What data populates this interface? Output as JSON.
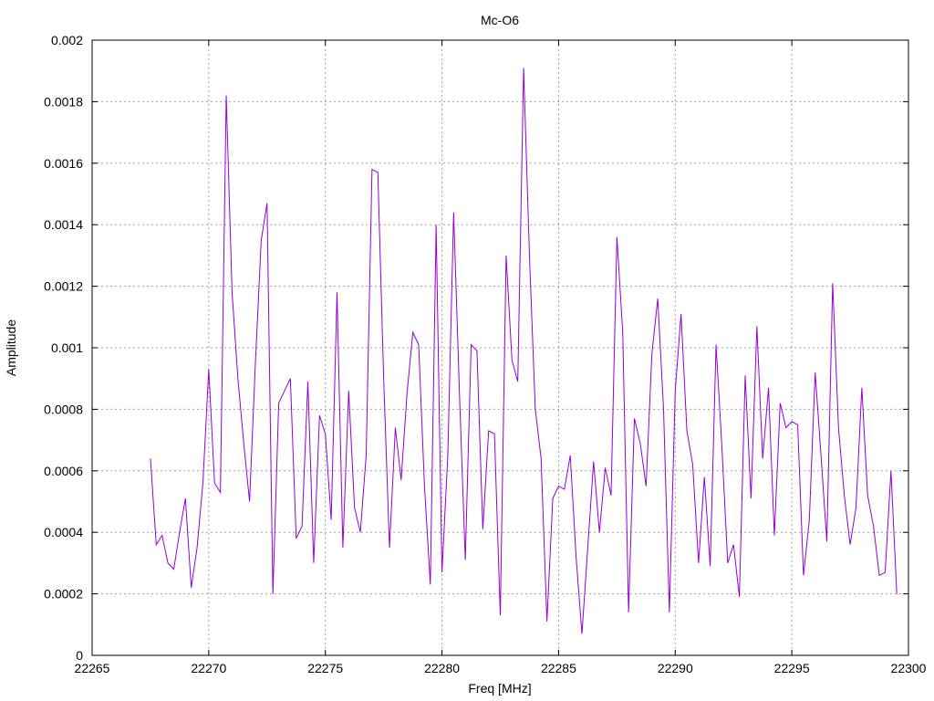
{
  "chart_data": {
    "type": "line",
    "title": "Mc-O6",
    "xlabel": "Freq [MHz]",
    "ylabel": "Amplitude",
    "xlim": [
      22265,
      22300
    ],
    "ylim": [
      0,
      0.002
    ],
    "x_ticks": [
      "22265",
      "22270",
      "22275",
      "22280",
      "22285",
      "22290",
      "22295",
      "22300"
    ],
    "y_ticks": [
      "0",
      "0.0002",
      "0.0004",
      "0.0006",
      "0.0008",
      "0.001",
      "0.0012",
      "0.0014",
      "0.0016",
      "0.0018",
      "0.002"
    ],
    "grid": true,
    "legend": "none",
    "line_color": "#9400d3",
    "series": [
      {
        "x": [
          22267.5,
          22267.75,
          22268.0,
          22268.25,
          22268.5,
          22268.75,
          22269.0,
          22269.25,
          22269.5,
          22269.75,
          22270.0,
          22270.25,
          22270.5,
          22270.75,
          22271.0,
          22271.25,
          22271.5,
          22271.75,
          22272.0,
          22272.25,
          22272.5,
          22272.75,
          22273.0,
          22273.25,
          22273.5,
          22273.75,
          22274.0,
          22274.25,
          22274.5,
          22274.75,
          22275.0,
          22275.25,
          22275.5,
          22275.75,
          22276.0,
          22276.25,
          22276.5,
          22276.75,
          22277.0,
          22277.25,
          22277.5,
          22277.75,
          22278.0,
          22278.25,
          22278.5,
          22278.75,
          22279.0,
          22279.25,
          22279.5,
          22279.75,
          22280.0,
          22280.25,
          22280.5,
          22280.75,
          22281.0,
          22281.25,
          22281.5,
          22281.75,
          22282.0,
          22282.25,
          22282.5,
          22282.75,
          22283.0,
          22283.25,
          22283.5,
          22283.75,
          22284.0,
          22284.25,
          22284.5,
          22284.75,
          22285.0,
          22285.25,
          22285.5,
          22285.75,
          22286.0,
          22286.25,
          22286.5,
          22286.75,
          22287.0,
          22287.25,
          22287.5,
          22287.75,
          22288.0,
          22288.25,
          22288.5,
          22288.75,
          22289.0,
          22289.25,
          22289.5,
          22289.75,
          22290.0,
          22290.25,
          22290.5,
          22290.75,
          22291.0,
          22291.25,
          22291.5,
          22291.75,
          22292.0,
          22292.25,
          22292.5,
          22292.75,
          22293.0,
          22293.25,
          22293.5,
          22293.75,
          22294.0,
          22294.25,
          22294.5,
          22294.75,
          22295.0,
          22295.25,
          22295.5,
          22295.75,
          22296.0,
          22296.25,
          22296.5,
          22296.75,
          22297.0,
          22297.25,
          22297.5,
          22297.75,
          22298.0,
          22298.25,
          22298.5,
          22298.75,
          22299.0,
          22299.25,
          22299.5
        ],
        "values": [
          0.00064,
          0.00036,
          0.00039,
          0.0003,
          0.00028,
          0.0004,
          0.00051,
          0.00022,
          0.00035,
          0.00056,
          0.00093,
          0.00056,
          0.00053,
          0.00182,
          0.00118,
          0.0009,
          0.00069,
          0.0005,
          0.00095,
          0.00135,
          0.00147,
          0.0002,
          0.00082,
          0.00086,
          0.0009,
          0.00038,
          0.00042,
          0.00089,
          0.0003,
          0.00078,
          0.00072,
          0.00044,
          0.00118,
          0.00035,
          0.00086,
          0.00048,
          0.0004,
          0.00065,
          0.00158,
          0.00157,
          0.0009,
          0.00035,
          0.00074,
          0.00057,
          0.00085,
          0.00105,
          0.00101,
          0.00055,
          0.00023,
          0.0014,
          0.00027,
          0.00065,
          0.00144,
          0.00085,
          0.00031,
          0.00101,
          0.00099,
          0.00041,
          0.00073,
          0.00072,
          0.00013,
          0.0013,
          0.00096,
          0.00089,
          0.00191,
          0.0013,
          0.0008,
          0.00064,
          0.00011,
          0.00051,
          0.00055,
          0.00054,
          0.00065,
          0.00032,
          7e-05,
          0.00035,
          0.00063,
          0.0004,
          0.00061,
          0.00052,
          0.00136,
          0.00105,
          0.00014,
          0.00077,
          0.00069,
          0.00055,
          0.00098,
          0.00116,
          0.0008,
          0.00014,
          0.00086,
          0.00111,
          0.00073,
          0.00062,
          0.0003,
          0.00058,
          0.00029,
          0.00101,
          0.00068,
          0.0003,
          0.00036,
          0.00019,
          0.00091,
          0.00051,
          0.00107,
          0.00064,
          0.00087,
          0.00039,
          0.00082,
          0.00074,
          0.00076,
          0.00075,
          0.00026,
          0.00044,
          0.00092,
          0.00065,
          0.00037,
          0.00121,
          0.00074,
          0.00052,
          0.00036,
          0.00048,
          0.00087,
          0.00052,
          0.00042,
          0.00026,
          0.00027,
          0.0006,
          0.0002
        ]
      }
    ]
  }
}
